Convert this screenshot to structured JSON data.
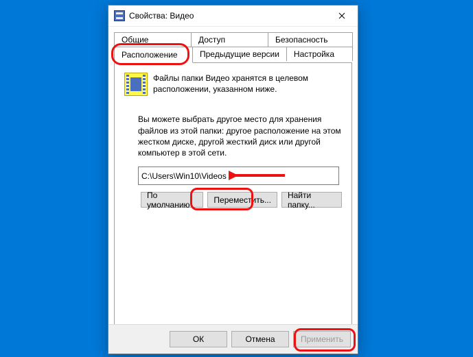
{
  "window": {
    "title": "Свойства: Видео"
  },
  "tabs": {
    "row1": [
      "Общие",
      "Доступ",
      "Безопасность"
    ],
    "row2": [
      "Расположение",
      "Предыдущие версии",
      "Настройка"
    ],
    "active": "Расположение"
  },
  "body": {
    "desc1": "Файлы папки Видео хранятся в целевом расположении, указанном ниже.",
    "desc2": "Вы можете выбрать другое место для хранения файлов из этой папки: другое расположение на этом жестком диске, другой жесткий диск или другой компьютер в этой сети.",
    "path": "C:\\Users\\Win10\\Videos"
  },
  "buttons": {
    "default": "По умолчанию",
    "move": "Переместить...",
    "find": "Найти папку..."
  },
  "footer": {
    "ok": "ОК",
    "cancel": "Отмена",
    "apply": "Применить"
  }
}
